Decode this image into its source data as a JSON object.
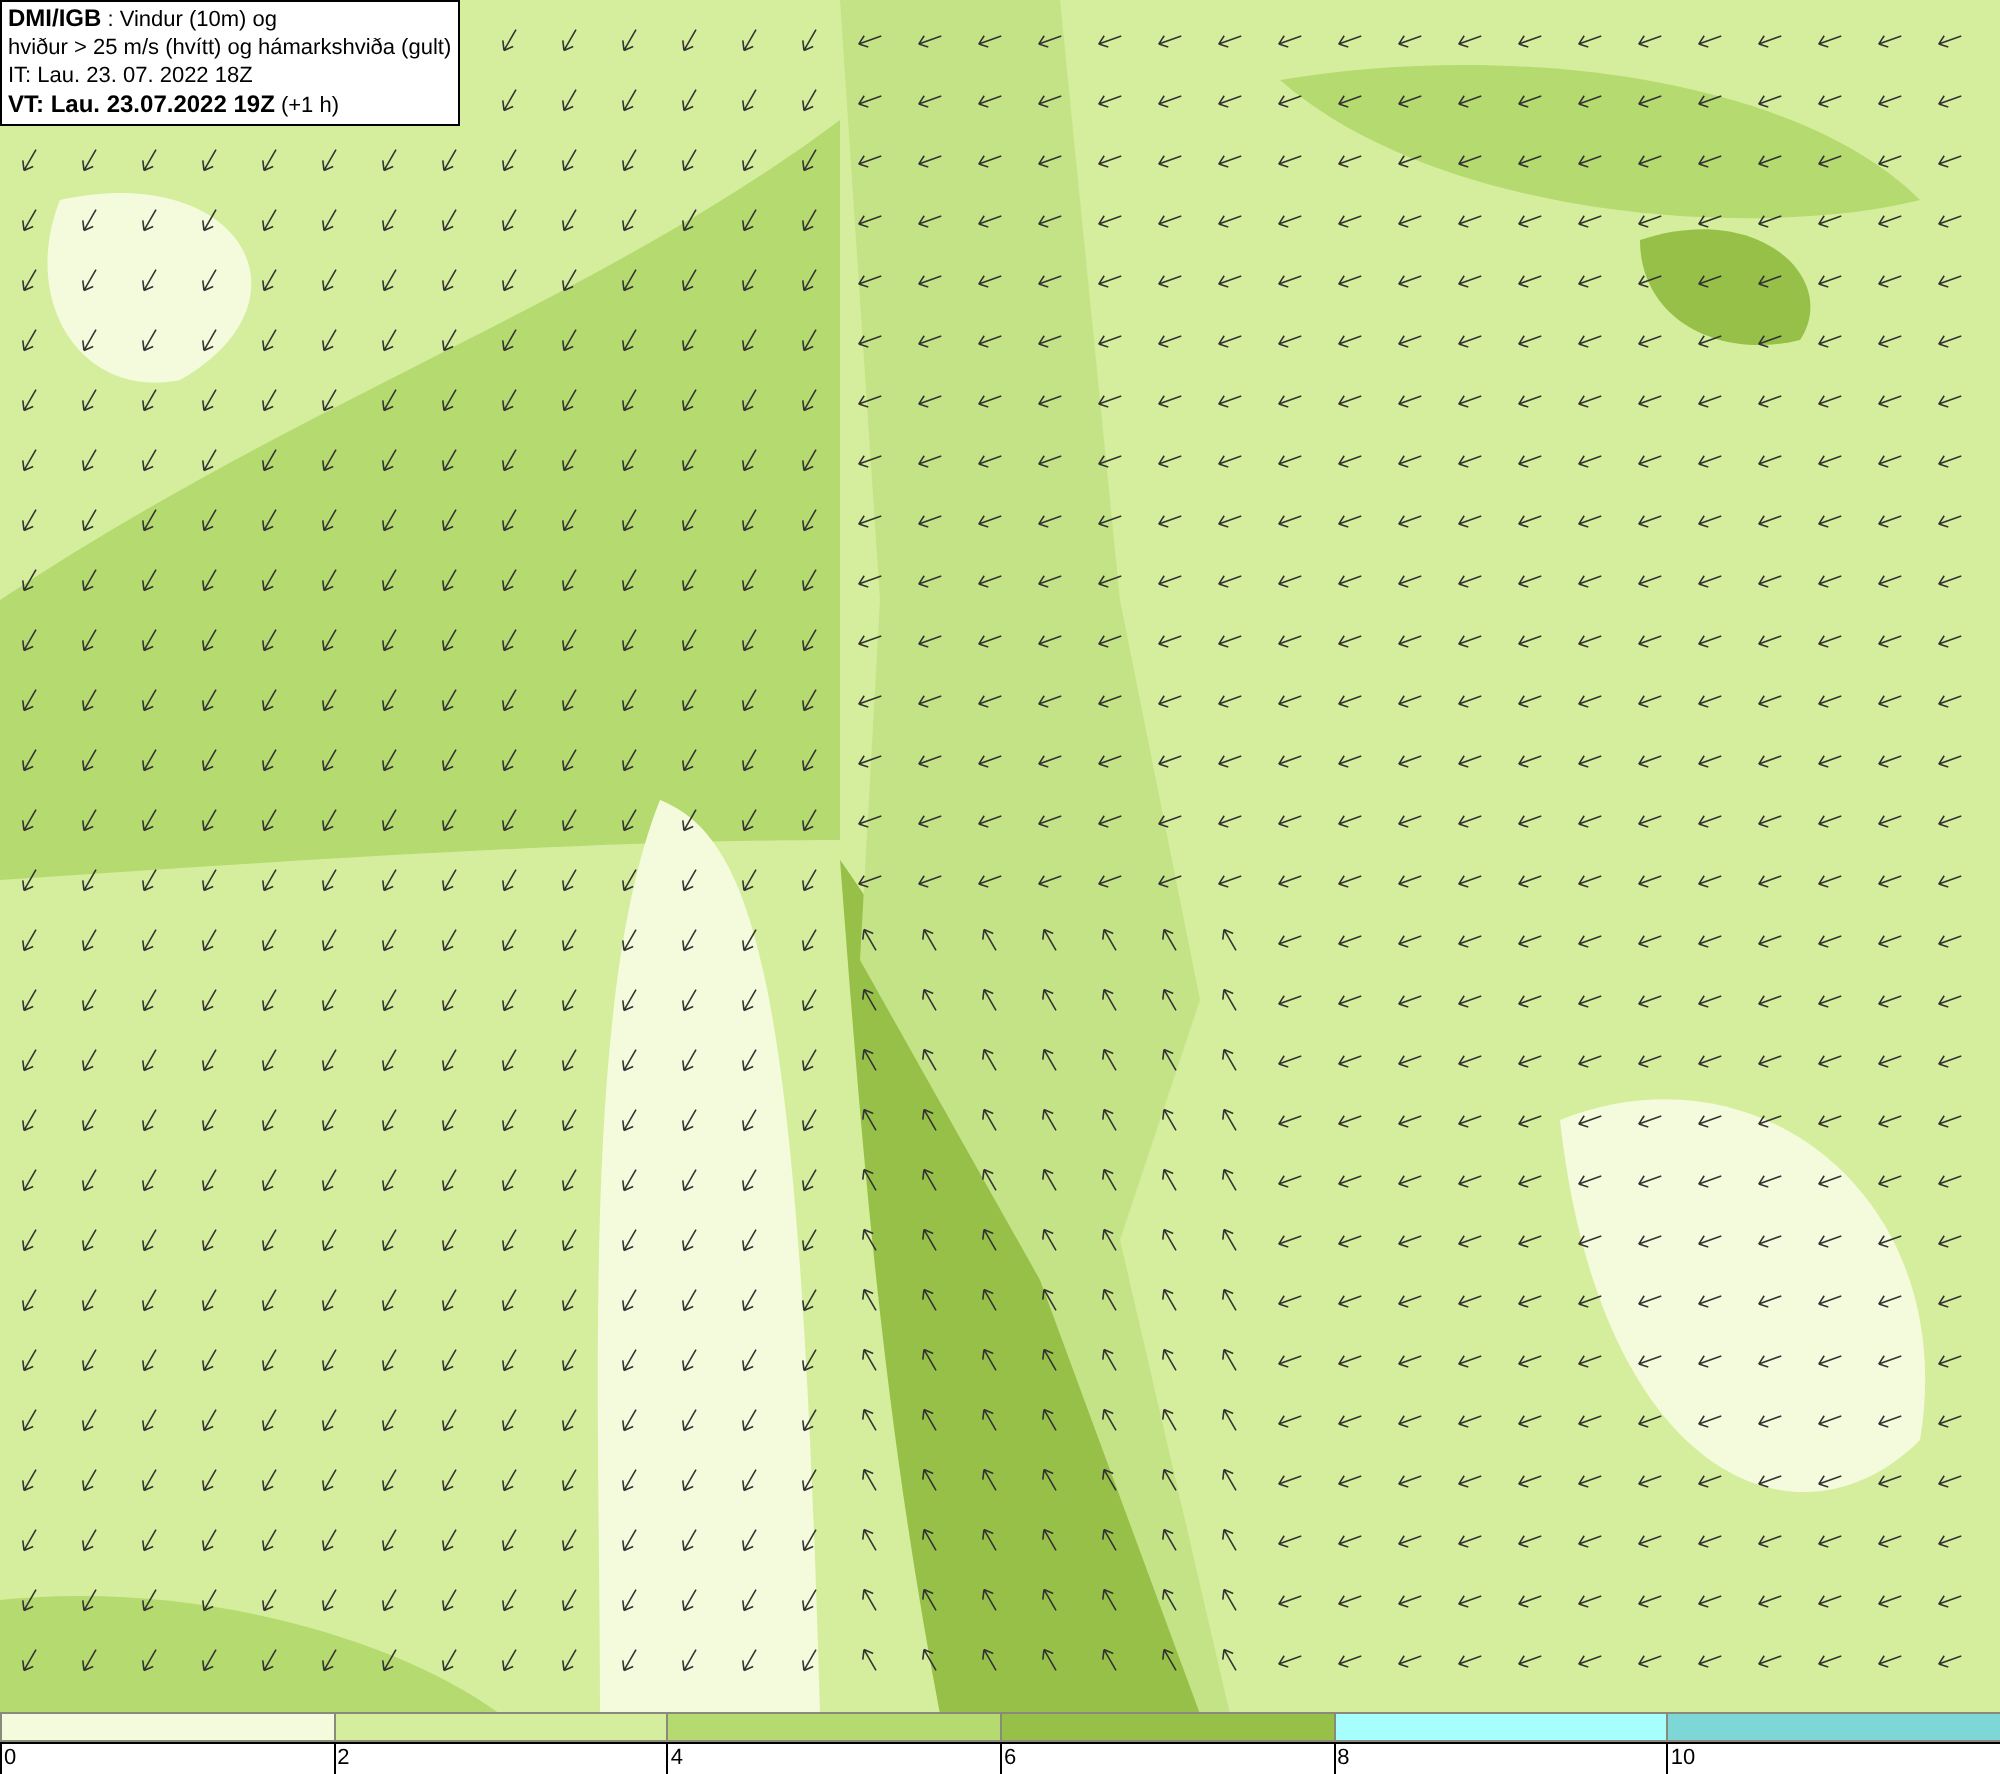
{
  "title_box": {
    "lines": [
      "**DMI/IGB** : Vindur (10m) og",
      "hviður > 25 m/s (hvítt) og hámarkshviða (gult)",
      "IT: Lau. 23. 07. 2022 18Z",
      "**VT: Lau. 23.07.2022 19Z** (+1 h)"
    ]
  },
  "legend": {
    "segments": [
      {
        "color": "#f4fbdc",
        "label": "0"
      },
      {
        "color": "#d5ee9d",
        "label": "2"
      },
      {
        "color": "#b5da6f",
        "label": "4"
      },
      {
        "color": "#97c049",
        "label": "6"
      },
      {
        "color": "#a6fefe",
        "label": "8"
      },
      {
        "color": "#7dd7d7",
        "label": "10"
      }
    ]
  }
}
